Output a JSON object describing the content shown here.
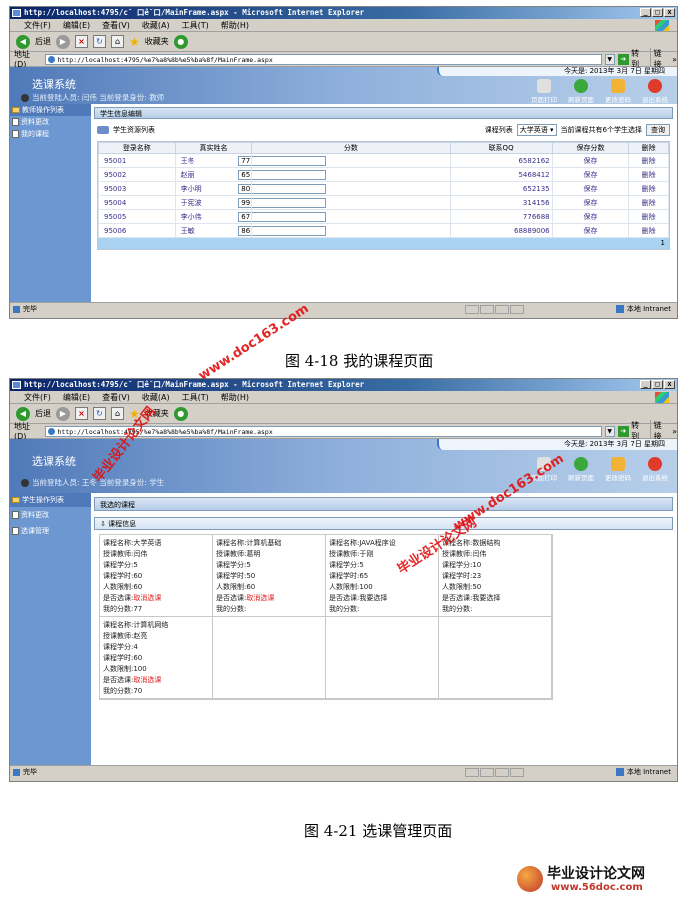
{
  "window": {
    "title": "http://localhost:4795/c˘ 口ê˘口/MainFrame.aspx - Microsoft Internet Explorer",
    "title_short_1": "http://localhost:4795/c˘ 口ê˘口/MainFrame.aspx - Microsoft Internet Explorer",
    "controls": [
      "_",
      "□",
      "x"
    ]
  },
  "menu": [
    "文件(F)",
    "编辑(E)",
    "查看(V)",
    "收藏(A)",
    "工具(T)",
    "帮助(H)"
  ],
  "toolbar": {
    "back": "后退",
    "favorites": "收藏夹"
  },
  "address": {
    "label": "地址(D)",
    "url": "http://localhost:4795/%e7%a8%8b%e5%ba%8f/MainFrame.aspx",
    "go": "转到",
    "links": "链接",
    "more": "»"
  },
  "header": {
    "system_title": "选课系统",
    "date": "今天是: 2013年 3月 7日 星期四",
    "buttons": [
      "页面打印",
      "刷新页面",
      "更改密码",
      "退出系统"
    ]
  },
  "screen1": {
    "login_info": "当前登陆人员: 闫伟  当前登录身份: 教师",
    "left_menu_head": "教师操作列表",
    "left_menu": [
      "资料更改",
      "我的课程"
    ],
    "panel_title": "学生信息编辑",
    "list_title": "学生资源列表",
    "course_list_label": "课程列表",
    "course_selected": "大学英语",
    "count_text": "当前课程共有6个学生选择",
    "query_button": "查询",
    "columns": [
      "登录名称",
      "真实姓名",
      "分数",
      "联系QQ",
      "保存分数",
      "删除"
    ],
    "rows": [
      {
        "login": "95001",
        "name": "王冬",
        "score": "77",
        "qq": "6582162",
        "save": "保存",
        "del": "删除"
      },
      {
        "login": "95002",
        "name": "赵丽",
        "score": "65",
        "qq": "5468412",
        "save": "保存",
        "del": "删除"
      },
      {
        "login": "95003",
        "name": "李小明",
        "score": "80",
        "qq": "652135",
        "save": "保存",
        "del": "删除"
      },
      {
        "login": "95004",
        "name": "于宪波",
        "score": "99",
        "qq": "314156",
        "save": "保存",
        "del": "删除"
      },
      {
        "login": "95005",
        "name": "李小伟",
        "score": "67",
        "qq": "776688",
        "save": "保存",
        "del": "删除"
      },
      {
        "login": "95006",
        "name": "王敏",
        "score": "86",
        "qq": "68889006",
        "save": "保存",
        "del": "删除"
      }
    ],
    "page_number": "1",
    "status_done": "完毕",
    "status_zone": "本地 Intranet",
    "caption": "图 4-18 我的课程页面"
  },
  "screen2": {
    "login_info": "当前登陆人员: 王冬  当前登录身份: 学生",
    "left_menu_head": "学生操作列表",
    "left_menu": [
      "资料更改",
      "选课管理"
    ],
    "panel_title": "我选的课程",
    "sub_title": "课程信息",
    "cards": [
      {
        "name": "课程名称:大学英语",
        "teacher": "授课教师:闫伟",
        "credit": "课程学分:5",
        "hours": "课程学时:60",
        "limit": "人数限制:60",
        "choose_label": "是否选课:",
        "choose": "取消选课",
        "choose_red": true,
        "score": "我的分数:77"
      },
      {
        "name": "课程名称:计算机基础",
        "teacher": "授课教师:葛明",
        "credit": "课程学分:5",
        "hours": "课程学时:50",
        "limit": "人数限制:60",
        "choose_label": "是否选课:",
        "choose": "取消选课",
        "choose_red": true,
        "score": "我的分数:"
      },
      {
        "name": "课程名称:JAVA程序设",
        "teacher": "授课教师:于刚",
        "credit": "课程学分:5",
        "hours": "课程学时:65",
        "limit": "人数限制:100",
        "choose_label": "是否选课:",
        "choose": "我要选择",
        "choose_red": false,
        "score": "我的分数:"
      },
      {
        "name": "课程名称:数据结构",
        "teacher": "授课教师:闫伟",
        "credit": "课程学分:10",
        "hours": "课程学时:23",
        "limit": "人数限制:50",
        "choose_label": "是否选课:",
        "choose": "我要选择",
        "choose_red": false,
        "score": "我的分数:"
      },
      {
        "name": "课程名称:计算机网络",
        "teacher": "授课教师:赵亮",
        "credit": "课程学分:4",
        "hours": "课程学时:60",
        "limit": "人数限制:100",
        "choose_label": "是否选课:",
        "choose": "取消选课",
        "choose_red": true,
        "score": "我的分数:70"
      }
    ],
    "status_done": "完毕",
    "status_zone": "本地 Intranet",
    "caption": "图 4-21 选课管理页面"
  },
  "watermarks": {
    "site": "www.doc163.com",
    "cn": "毕业设计论文网"
  },
  "footer": {
    "logo_cn": "毕业设计论文网",
    "logo_url": "www.56doc.com"
  }
}
